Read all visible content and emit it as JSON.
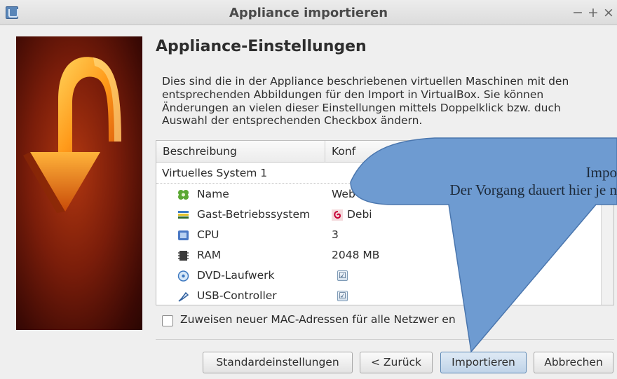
{
  "window": {
    "title": "Appliance importieren",
    "controls": [
      "−",
      "+",
      "×"
    ]
  },
  "page": {
    "heading": "Appliance-Einstellungen",
    "description": "Dies sind die in der Appliance beschriebenen virtuellen Maschinen mit den entsprechenden Abbildungen für den Import in VirtualBox. Sie können Änderungen an vielen dieser Einstellungen mittels Doppelklick bzw. duch Auswahl der entsprechenden Checkbox ändern."
  },
  "table": {
    "headers": [
      "Beschreibung",
      "Konf"
    ],
    "system_label": "Virtuelles System 1",
    "rows": [
      {
        "label": "Name",
        "value": "Web",
        "icon": "name-icon"
      },
      {
        "label": "Gast-Betriebssystem",
        "value": "Debi",
        "icon": "os-icon"
      },
      {
        "label": "CPU",
        "value": "3",
        "icon": "cpu-icon"
      },
      {
        "label": "RAM",
        "value": "2048 MB",
        "icon": "ram-icon"
      },
      {
        "label": "DVD-Laufwerk",
        "value": "☑",
        "icon": "dvd-icon"
      },
      {
        "label": "USB-Controller",
        "value": "☑",
        "icon": "usb-icon"
      }
    ]
  },
  "mac_checkbox": {
    "label": "Zuweisen neuer MAC-Adressen für alle Netzwer    en",
    "checked": false
  },
  "buttons": {
    "defaults": "Standardeinstellungen",
    "back": "< Zurück",
    "import": "Impo­rtieren",
    "cancel": "Abbrechen"
  },
  "callout": {
    "line1": "Impo",
    "line2": "Der Vorgang dauert hier je n",
    "color": "#6e9bd1"
  }
}
